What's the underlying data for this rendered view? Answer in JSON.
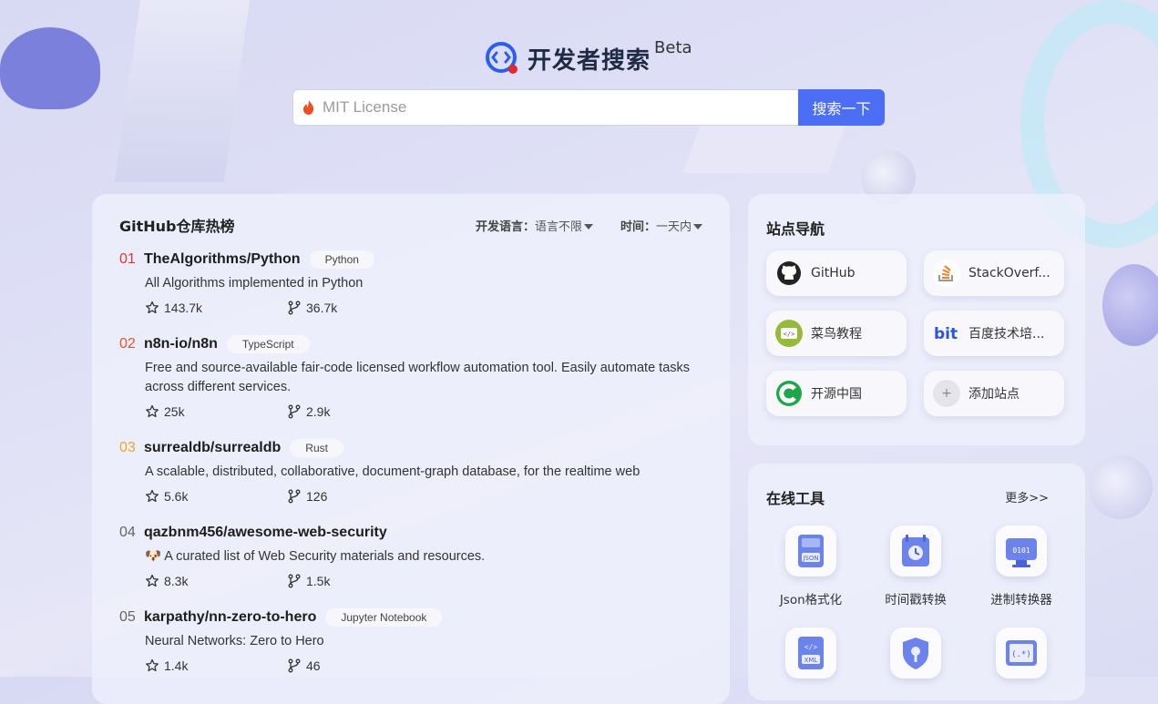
{
  "header": {
    "logo_text": "开发者搜索",
    "beta": "Beta",
    "search_placeholder": "MIT License",
    "search_button": "搜索一下"
  },
  "github": {
    "title": "GitHub仓库热榜",
    "filter_lang_label": "开发语言：",
    "filter_lang_value": "语言不限",
    "filter_time_label": "时间：",
    "filter_time_value": "一天内",
    "repos": [
      {
        "rank": "01",
        "name": "TheAlgorithms/Python",
        "lang": "Python",
        "desc": "All Algorithms implemented in Python",
        "stars": "143.7k",
        "forks": "36.7k"
      },
      {
        "rank": "02",
        "name": "n8n-io/n8n",
        "lang": "TypeScript",
        "desc": "Free and source-available fair-code licensed workflow automation tool. Easily automate tasks across different services.",
        "stars": "25k",
        "forks": "2.9k"
      },
      {
        "rank": "03",
        "name": "surrealdb/surrealdb",
        "lang": "Rust",
        "desc": "A scalable, distributed, collaborative, document-graph database, for the realtime web",
        "stars": "5.6k",
        "forks": "126"
      },
      {
        "rank": "04",
        "name": "qazbnm456/awesome-web-security",
        "lang": "",
        "desc": "🐶 A curated list of Web Security materials and resources.",
        "stars": "8.3k",
        "forks": "1.5k"
      },
      {
        "rank": "05",
        "name": "karpathy/nn-zero-to-hero",
        "lang": "Jupyter Notebook",
        "desc": "Neural Networks: Zero to Hero",
        "stars": "1.4k",
        "forks": "46"
      }
    ]
  },
  "nav": {
    "title": "站点导航",
    "sites": [
      {
        "label": "GitHub",
        "icon": "github-icon"
      },
      {
        "label": "StackOverf...",
        "icon": "stackoverflow-icon"
      },
      {
        "label": "菜鸟教程",
        "icon": "runoob-icon"
      },
      {
        "label": "百度技术培...",
        "icon": "baidu-bit-icon"
      },
      {
        "label": "开源中国",
        "icon": "oschina-icon"
      },
      {
        "label": "添加站点",
        "icon": "plus-icon"
      }
    ]
  },
  "tools": {
    "title": "在线工具",
    "more": "更多>>",
    "items": [
      {
        "label": "Json格式化",
        "icon": "json-icon"
      },
      {
        "label": "时间戳转换",
        "icon": "timestamp-icon"
      },
      {
        "label": "进制转换器",
        "icon": "binary-icon"
      },
      {
        "label": "",
        "icon": "xml-icon"
      },
      {
        "label": "",
        "icon": "shield-key-icon"
      },
      {
        "label": "",
        "icon": "regex-icon"
      }
    ]
  },
  "colors": {
    "accent": "#4c6ef5",
    "rank1": "#e0362b",
    "rank2": "#e0572b",
    "rank3": "#e5ab2a"
  }
}
